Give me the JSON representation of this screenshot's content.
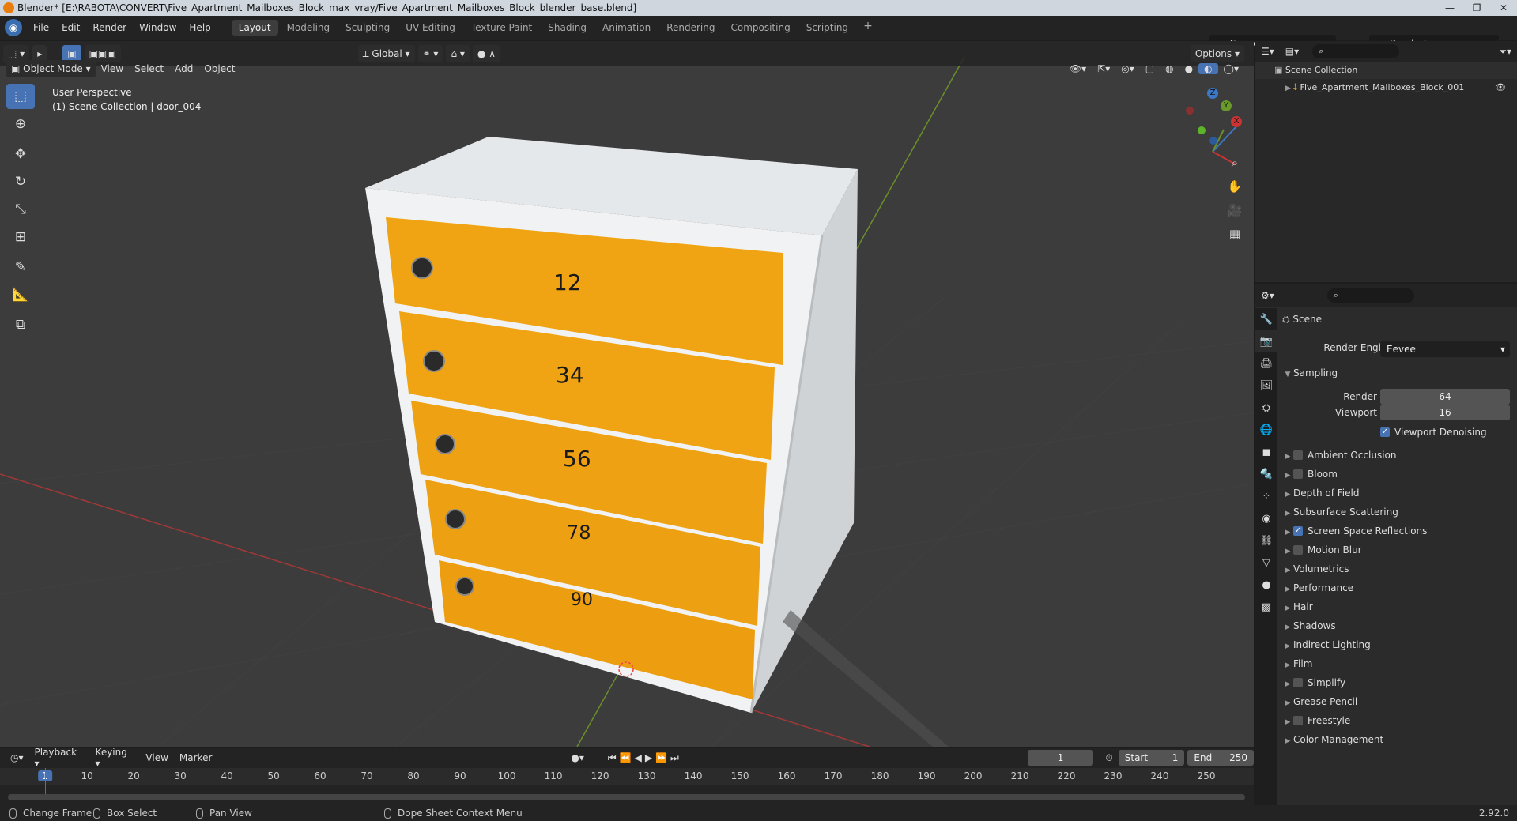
{
  "window": {
    "title": "Blender* [E:\\RABOTA\\CONVERT\\Five_Apartment_Mailboxes_Block_max_vray/Five_Apartment_Mailboxes_Block_blender_base.blend]"
  },
  "menu": {
    "file": "File",
    "edit": "Edit",
    "render": "Render",
    "window": "Window",
    "help": "Help"
  },
  "workspaces": [
    "Layout",
    "Modeling",
    "Sculpting",
    "UV Editing",
    "Texture Paint",
    "Shading",
    "Animation",
    "Rendering",
    "Compositing",
    "Scripting"
  ],
  "scene": {
    "name": "Scene",
    "view_layer": "RenderLayer"
  },
  "viewport": {
    "mode": "Object Mode",
    "menus": [
      "View",
      "Select",
      "Add",
      "Object"
    ],
    "orientation": "Global",
    "options": "Options",
    "view_name": "User Perspective",
    "collection_info": "(1) Scene Collection | door_004",
    "axis_labels": {
      "x": "X",
      "y": "Y",
      "z": "Z"
    }
  },
  "mailboxes": [
    "12",
    "34",
    "56",
    "78",
    "90"
  ],
  "outliner": {
    "root": "Scene Collection",
    "item": "Five_Apartment_Mailboxes_Block_001"
  },
  "properties": {
    "context": "Scene",
    "render_engine_label": "Render Engine",
    "render_engine": "Eevee",
    "sampling": {
      "label": "Sampling",
      "render_label": "Render",
      "render": "64",
      "viewport_label": "Viewport",
      "viewport": "16",
      "denoise_label": "Viewport Denoising",
      "denoise": true
    },
    "panels": [
      {
        "label": "Ambient Occlusion",
        "checkbox": true,
        "checked": false
      },
      {
        "label": "Bloom",
        "checkbox": true,
        "checked": false
      },
      {
        "label": "Depth of Field",
        "checkbox": false
      },
      {
        "label": "Subsurface Scattering",
        "checkbox": false
      },
      {
        "label": "Screen Space Reflections",
        "checkbox": true,
        "checked": true
      },
      {
        "label": "Motion Blur",
        "checkbox": true,
        "checked": false
      },
      {
        "label": "Volumetrics",
        "checkbox": false
      },
      {
        "label": "Performance",
        "checkbox": false
      },
      {
        "label": "Hair",
        "checkbox": false
      },
      {
        "label": "Shadows",
        "checkbox": false
      },
      {
        "label": "Indirect Lighting",
        "checkbox": false
      },
      {
        "label": "Film",
        "checkbox": false
      },
      {
        "label": "Simplify",
        "checkbox": true,
        "checked": false
      },
      {
        "label": "Grease Pencil",
        "checkbox": false
      },
      {
        "label": "Freestyle",
        "checkbox": true,
        "checked": false
      },
      {
        "label": "Color Management",
        "checkbox": false
      }
    ]
  },
  "timeline": {
    "menus": [
      "Playback",
      "Keying",
      "View",
      "Marker"
    ],
    "current_frame": "1",
    "start_label": "Start",
    "start": "1",
    "end_label": "End",
    "end": "250",
    "ticks": [
      "1",
      "10",
      "20",
      "30",
      "40",
      "50",
      "60",
      "70",
      "80",
      "90",
      "100",
      "110",
      "120",
      "130",
      "140",
      "150",
      "160",
      "170",
      "180",
      "190",
      "200",
      "210",
      "220",
      "230",
      "240",
      "250"
    ]
  },
  "status": {
    "change_frame": "Change Frame",
    "box_select": "Box Select",
    "pan_view": "Pan View",
    "context_menu": "Dope Sheet Context Menu",
    "version": "2.92.0"
  },
  "colors": {
    "accent": "#4772b3",
    "mailbox": "#f0a413",
    "frame": "#e9ecef"
  }
}
